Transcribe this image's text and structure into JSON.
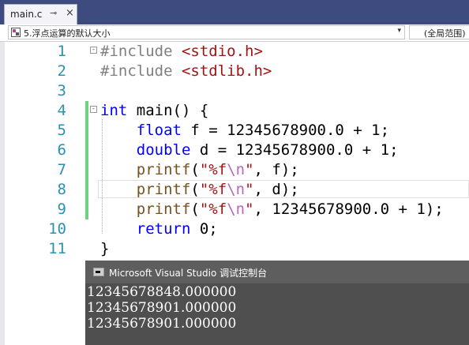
{
  "tab": {
    "filename": "main.c",
    "pin_glyph": "⊸",
    "close_glyph": "×"
  },
  "nav": {
    "scope": "5.浮点运算的默认大小",
    "member": "(全局范围)",
    "arrow": "▾"
  },
  "code": {
    "line_numbers": [
      "1",
      "2",
      "3",
      "4",
      "5",
      "6",
      "7",
      "8",
      "9",
      "10",
      "11"
    ],
    "line1": {
      "directive": "#include",
      "header": "<stdio.h>"
    },
    "line2": {
      "directive": "#include",
      "header": "<stdlib.h>"
    },
    "line4": {
      "type": "int",
      "name": "main",
      "rest": "() {"
    },
    "line5": {
      "type": "float",
      "rest": " f = 12345678900.0 + 1;"
    },
    "line6": {
      "type": "double",
      "rest": " d = 12345678900.0 + 1;"
    },
    "line7": {
      "fn": "printf",
      "open": "(",
      "str1": "\"%f",
      "esc": "\\n",
      "str2": "\"",
      "rest": ", f);"
    },
    "line8": {
      "fn": "printf",
      "open": "(",
      "str1": "\"%f",
      "esc": "\\n",
      "str2": "\"",
      "rest": ", d);"
    },
    "line9": {
      "fn": "printf",
      "open": "(",
      "str1": "\"%f",
      "esc": "\\n",
      "str2": "\"",
      "rest": ", 12345678900.0 + 1);"
    },
    "line10": {
      "kw": "return",
      "rest": " 0;"
    },
    "line11": {
      "text": "}"
    }
  },
  "console": {
    "title": "Microsoft Visual Studio 调试控制台",
    "lines": [
      "12345678848.000000",
      "12345678901.000000",
      "12345678901.000000"
    ]
  },
  "colors": {
    "accent": "#3d4b7e",
    "line_numbers": "#2b91af",
    "keyword": "#0000ff",
    "string": "#a31515",
    "change_bar": "#6dd37e"
  }
}
